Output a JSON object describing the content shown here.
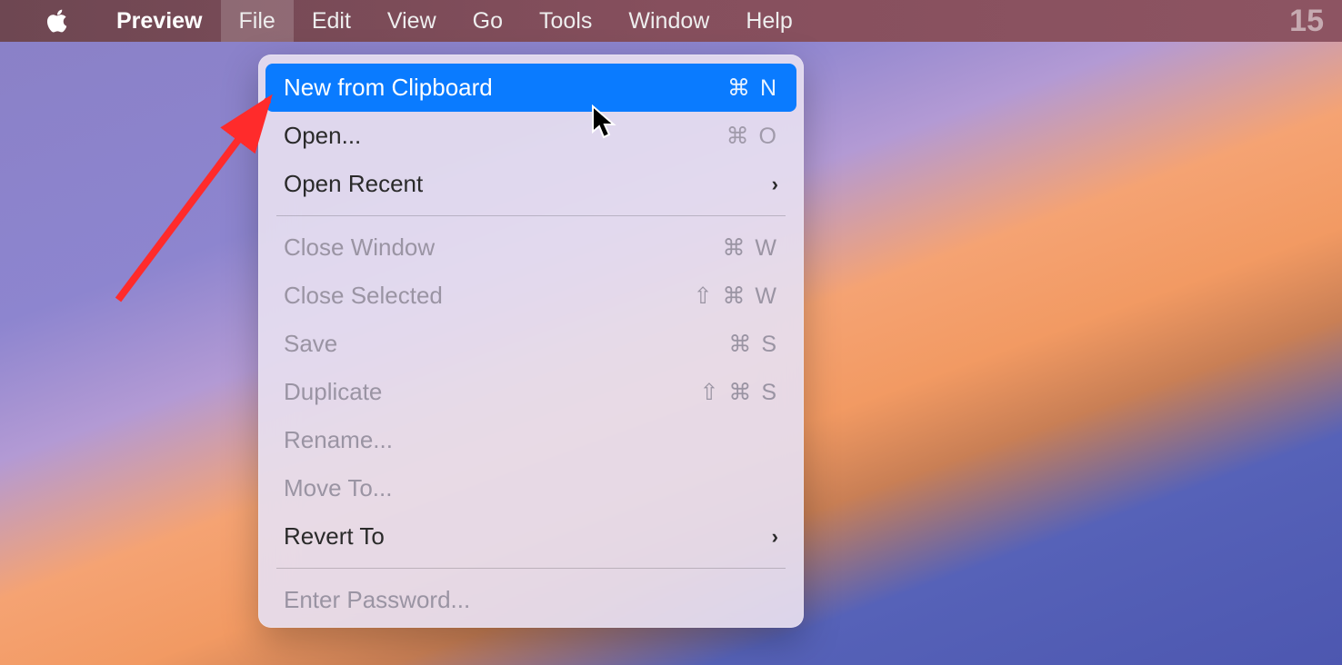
{
  "menubar": {
    "app_name": "Preview",
    "items": [
      {
        "label": "File"
      },
      {
        "label": "Edit"
      },
      {
        "label": "View"
      },
      {
        "label": "Go"
      },
      {
        "label": "Tools"
      },
      {
        "label": "Window"
      },
      {
        "label": "Help"
      }
    ],
    "clock": "15"
  },
  "dropdown": {
    "items": [
      {
        "label": "New from Clipboard",
        "shortcut": "⌘ N",
        "highlight": true
      },
      {
        "label": "Open...",
        "shortcut": "⌘ O"
      },
      {
        "label": "Open Recent",
        "submenu": true
      },
      {
        "sep": true
      },
      {
        "label": "Close Window",
        "shortcut": "⌘ W",
        "disabled": true
      },
      {
        "label": "Close Selected",
        "shortcut": "⇧ ⌘ W",
        "disabled": true
      },
      {
        "label": "Save",
        "shortcut": "⌘ S",
        "disabled": true
      },
      {
        "label": "Duplicate",
        "shortcut": "⇧ ⌘ S",
        "disabled": true
      },
      {
        "label": "Rename...",
        "disabled": true
      },
      {
        "label": "Move To...",
        "disabled": true
      },
      {
        "label": "Revert To",
        "submenu": true
      },
      {
        "sep": true
      },
      {
        "label": "Enter Password...",
        "disabled": true
      }
    ]
  },
  "icons": {
    "chevron_right": "›"
  }
}
